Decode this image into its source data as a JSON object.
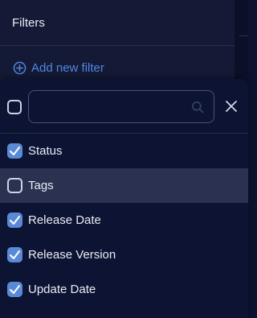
{
  "filters_panel": {
    "title": "Filters",
    "add_filter_label": "Add new filter"
  },
  "colors": {
    "accent": "#4f86e0",
    "checkbox_checked": "#5a8ad6",
    "panel_bg": "#141a36",
    "dropdown_bg": "#0d1332",
    "hover_row": "#2b3150"
  },
  "dropdown": {
    "search": {
      "value": "",
      "placeholder": ""
    },
    "options": [
      {
        "label": "Status",
        "checked": true
      },
      {
        "label": "Tags",
        "checked": false
      },
      {
        "label": "Release Date",
        "checked": true
      },
      {
        "label": "Release Version",
        "checked": true
      },
      {
        "label": "Update Date",
        "checked": true
      }
    ]
  }
}
